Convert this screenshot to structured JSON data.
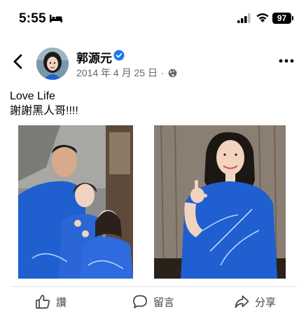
{
  "status_bar": {
    "time": "5:55",
    "battery": "97",
    "icons": [
      "bed-icon",
      "signal-icon",
      "wifi-icon",
      "battery-icon"
    ]
  },
  "header": {
    "author": "郭源元",
    "date": "2014 年 4 月 25 日",
    "dot": "·",
    "icons": [
      "back-arrow-icon",
      "verified-icon",
      "globe-icon",
      "more-icon"
    ]
  },
  "post": {
    "lines": [
      "Love Life",
      "謝謝黑人哥!!!!"
    ]
  },
  "actions": {
    "like": "讚",
    "comment": "留言",
    "share": "分享"
  },
  "colors": {
    "verified": "#1877f2",
    "meta": "#65676b",
    "shirt": "#1f5fcf",
    "divider": "#e4e6eb"
  }
}
